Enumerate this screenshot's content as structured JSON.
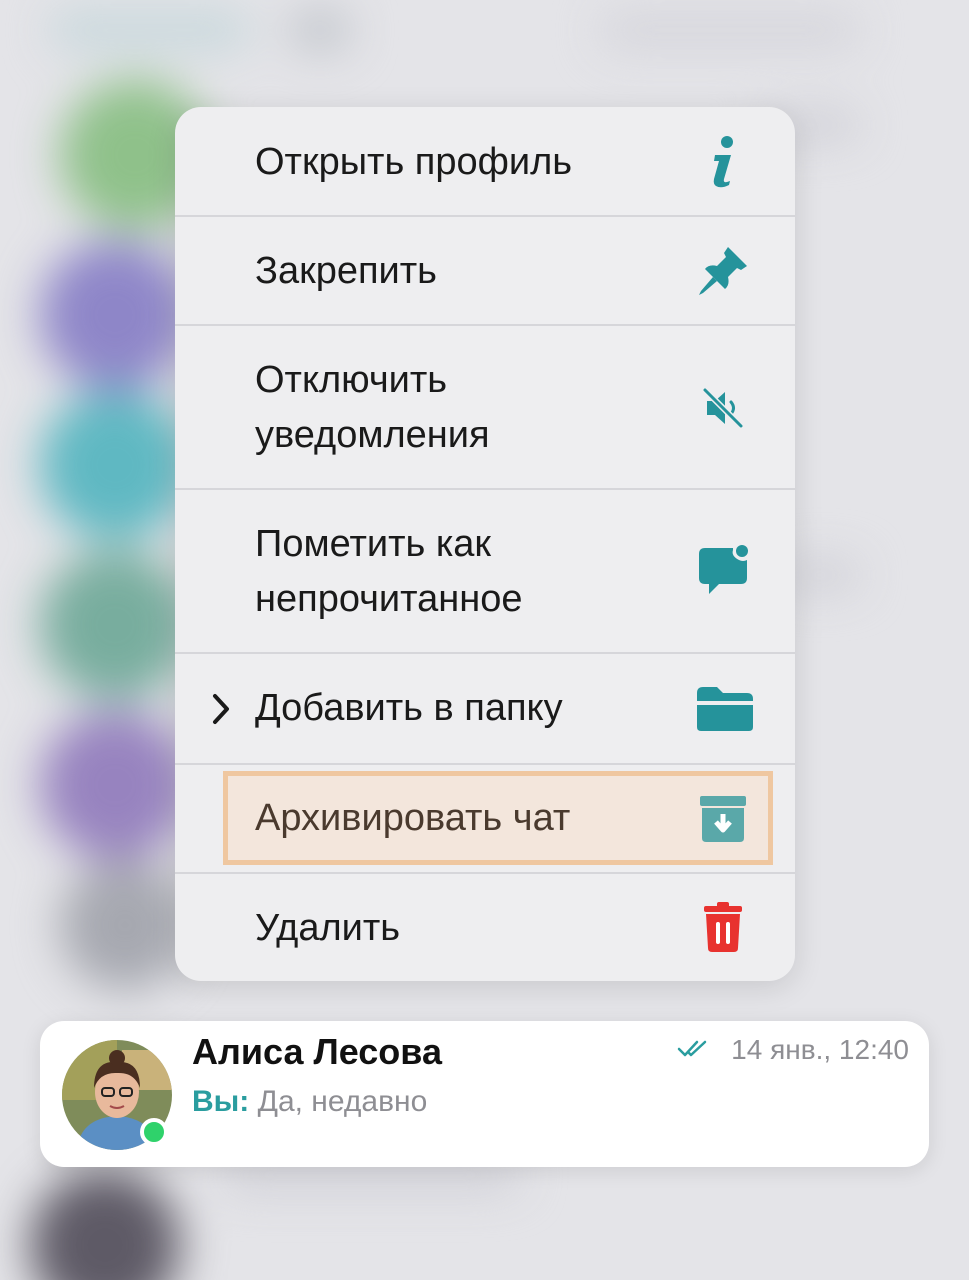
{
  "colors": {
    "accent": "#25939b",
    "danger": "#e8322f",
    "highlight_fill": "#f3e6dc",
    "highlight_border": "#efc7a0",
    "online": "#2fd26b"
  },
  "menu": {
    "items": [
      {
        "label": "Открыть профиль",
        "icon": "info-icon"
      },
      {
        "label": "Закрепить",
        "icon": "pin-icon"
      },
      {
        "label": "Отключить\nуведомления",
        "icon": "mute-icon"
      },
      {
        "label": "Пометить как\nнепрочитанное",
        "icon": "unread-message-icon"
      },
      {
        "label": "Добавить в папку",
        "icon": "folder-icon",
        "has_submenu": true
      },
      {
        "label": "Архивировать чат",
        "icon": "archive-icon",
        "highlighted": true
      },
      {
        "label": "Удалить",
        "icon": "trash-icon"
      }
    ]
  },
  "chat": {
    "name": "Алиса Лесова",
    "time": "14 янв., 12:40",
    "sender": "Вы:",
    "preview": "Да, недавно",
    "online": true,
    "read_status": "double-check-icon"
  }
}
